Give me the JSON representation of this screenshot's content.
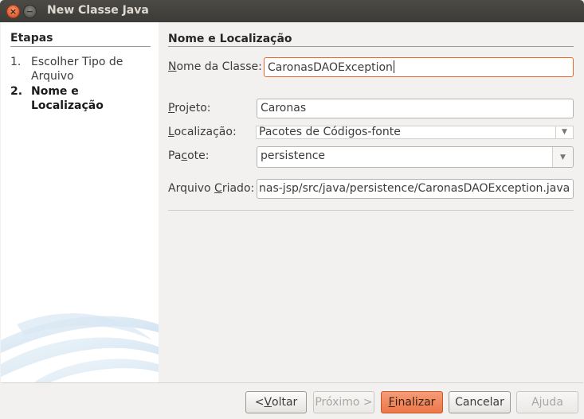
{
  "window": {
    "title": "New Classe Java",
    "close_glyph": "×",
    "minimize_glyph": "−"
  },
  "steps": {
    "heading": "Etapas",
    "items": [
      {
        "num": "1.",
        "label": "Escolher Tipo de Arquivo",
        "active": false
      },
      {
        "num": "2.",
        "label": "Nome e Localização",
        "active": true
      }
    ]
  },
  "section": {
    "heading": "Nome e Localização"
  },
  "form": {
    "class_name": {
      "label_pre": "",
      "label_mn": "N",
      "label_post": "ome da Classe:",
      "value": "CaronasDAOException"
    },
    "project": {
      "label_pre": "",
      "label_mn": "P",
      "label_post": "rojeto:",
      "value": "Caronas"
    },
    "location": {
      "label_pre": "",
      "label_mn": "L",
      "label_post": "ocalização:",
      "value": "Pacotes de Códigos-fonte"
    },
    "package": {
      "label_pre": "Pa",
      "label_mn": "c",
      "label_post": "ote:",
      "value": "persistence"
    },
    "created_file": {
      "label_pre": "Arquivo ",
      "label_mn": "C",
      "label_post": "riado:",
      "value": "nas-jsp/src/java/persistence/CaronasDAOException.java"
    }
  },
  "buttons": {
    "back": {
      "pre": "< ",
      "mn": "V",
      "post": "oltar"
    },
    "next": {
      "pre": "",
      "mn": "",
      "post": "Próximo >"
    },
    "finish": {
      "pre": "",
      "mn": "F",
      "post": "inalizar"
    },
    "cancel": {
      "pre": "",
      "mn": "",
      "post": "Cancelar"
    },
    "help": {
      "pre": "",
      "mn": "",
      "post": "Ajuda"
    }
  },
  "colors": {
    "accent": "#ec7748",
    "focus_border": "#e9692c",
    "titlebar": "#3c3b37"
  },
  "icons": {
    "close": "close-icon",
    "minimize": "minimize-icon",
    "dropdown": "chevron-down-icon"
  }
}
